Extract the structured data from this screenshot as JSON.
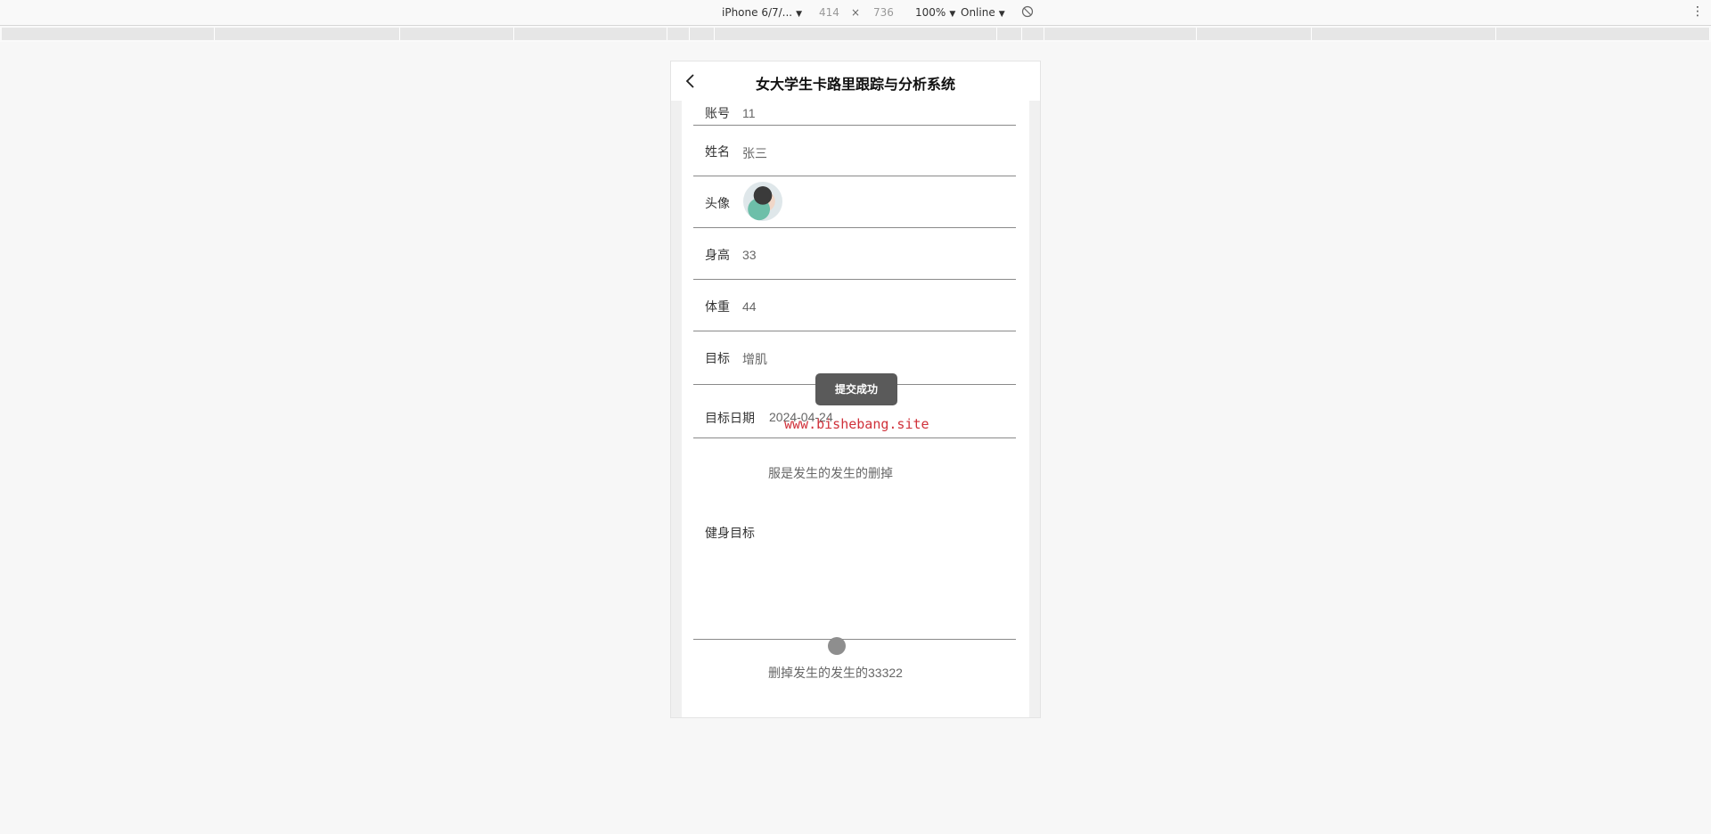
{
  "devtools": {
    "device": "iPhone 6/7/...",
    "width": "414",
    "times": "×",
    "height": "736",
    "zoom": "100%",
    "network": "Online",
    "menu": "⋮"
  },
  "app": {
    "title": "女大学生卡路里跟踪与分析系统"
  },
  "form": {
    "account_label": "账号",
    "account_value": "11",
    "name_label": "姓名",
    "name_value": "张三",
    "avatar_label": "头像",
    "height_label": "身高",
    "height_value": "33",
    "weight_label": "体重",
    "weight_value": "44",
    "goal_label": "目标",
    "goal_value": "增肌",
    "goal_date_label": "目标日期",
    "goal_date_value": "2024-04-24",
    "goal_date_note": "服是发生的发生的删掉",
    "fitness_goal_label": "健身目标",
    "fitness_goal_note": "删掉发生的发生的33322"
  },
  "toast": {
    "message": "提交成功"
  },
  "watermark": {
    "text": "www.bishebang.site"
  }
}
